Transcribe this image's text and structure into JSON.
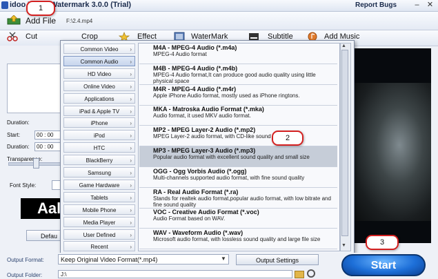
{
  "window": {
    "title": "idoo Video Watermark 3.0.0 (Trial)",
    "report_bugs": "Report Bugs",
    "minimize": "–",
    "close": "✕"
  },
  "add_file": {
    "label": "Add File",
    "path": "F:\\2.4.mp4"
  },
  "tabs": {
    "cut": "Cut",
    "crop": "Crop",
    "effect": "Effect",
    "watermark": "WaterMark",
    "subtitle": "Subtitle",
    "add_music": "Add Music"
  },
  "left_panel": {
    "duration_label": "Duration:",
    "start_label": "Start:",
    "start_value": "00 : 00",
    "duration2_label": "Duration:",
    "duration2_value": "00 : 00",
    "transparence_label": "Transparence:",
    "font_style_label": "Font Style:",
    "sample_text": "Aal",
    "default_button": "Defau"
  },
  "menu": {
    "categories": [
      {
        "label": "Common Video",
        "selected": false
      },
      {
        "label": "Common Audio",
        "selected": true
      },
      {
        "label": "HD Video",
        "selected": false
      },
      {
        "label": "Online Video",
        "selected": false
      },
      {
        "label": "Applications",
        "selected": false
      },
      {
        "label": "iPad & Apple TV",
        "selected": false
      },
      {
        "label": "iPhone",
        "selected": false
      },
      {
        "label": "iPod",
        "selected": false
      },
      {
        "label": "HTC",
        "selected": false
      },
      {
        "label": "BlackBerry",
        "selected": false
      },
      {
        "label": "Samsung",
        "selected": false
      },
      {
        "label": "Game Hardware",
        "selected": false
      },
      {
        "label": "Tablets",
        "selected": false
      },
      {
        "label": "Mobile Phone",
        "selected": false
      },
      {
        "label": "Media Player",
        "selected": false
      },
      {
        "label": "User Defined",
        "selected": false
      },
      {
        "label": "Recent",
        "selected": false
      }
    ],
    "arrow": "›",
    "formats": [
      {
        "title": "M4A - MPEG-4 Audio (*.m4a)",
        "desc": "MPEG-4 Audio format",
        "highlighted": false
      },
      {
        "title": "M4B - MPEG-4 Audio (*.m4b)",
        "desc": "MPEG-4 Audio format,It can produce good audio quality using little physical space",
        "highlighted": false
      },
      {
        "title": "M4R - MPEG-4 Audio (*.m4r)",
        "desc": "Apple iPhone Audio format, mostly used as iPhone ringtons.",
        "highlighted": false
      },
      {
        "title": "MKA - Matroska Audio Format (*.mka)",
        "desc": "Audio format, it used MKV audio format.",
        "highlighted": false
      },
      {
        "title": "MP2 - MPEG Layer-2 Audio (*.mp2)",
        "desc": "MPEG Layer-2 audio format, with CD-like sound quality",
        "highlighted": false
      },
      {
        "title": "MP3 - MPEG Layer-3 Audio (*.mp3)",
        "desc": "Popular audio format with excellent sound quality and small size",
        "highlighted": true
      },
      {
        "title": "OGG - Ogg Vorbis Audio (*.ogg)",
        "desc": "Multi-channels supported audio format, with fine sound quality",
        "highlighted": false
      },
      {
        "title": "RA - Real Audio Format (*.ra)",
        "desc": "Stands for realtek audio format,popular audio format, with low bitrate and fine sound quality",
        "highlighted": false
      },
      {
        "title": "VOC - Creative Audio Format (*.voc)",
        "desc": "Audio Format based on WAV.",
        "highlighted": false
      },
      {
        "title": "WAV - Waveform Audio (*.wav)",
        "desc": "Microsoft audio format, with lossless sound quality and large file size",
        "highlighted": false
      }
    ],
    "scroll_up": "▲",
    "scroll_down": "▼"
  },
  "callouts": {
    "one": "1",
    "two": "2",
    "three": "3"
  },
  "bottom": {
    "output_format_label": "Output Format:",
    "output_format_value": "Keep Original Video Format(*.mp4)",
    "output_settings": "Output Settings",
    "output_folder_label": "Output Folder:",
    "output_folder_value": "J:\\",
    "start_button": "Start"
  },
  "colors": {
    "accent_blue": "#1d6fd8",
    "callout_red": "#d42020",
    "menu_bg": "#f0f3f8"
  }
}
